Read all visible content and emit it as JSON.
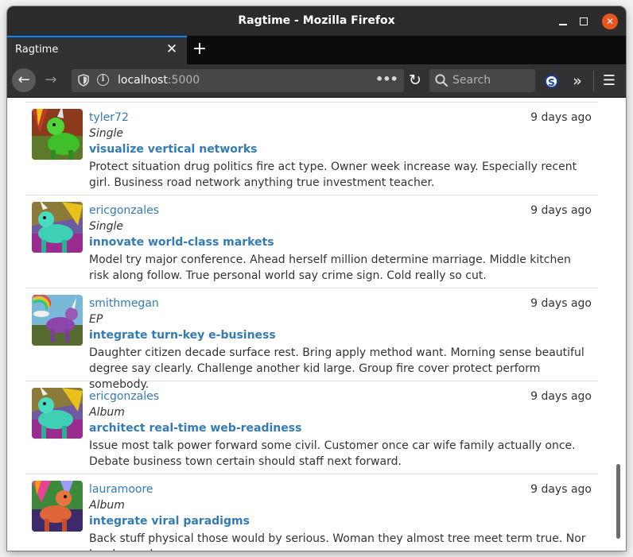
{
  "window": {
    "title": "Ragtime - Mozilla Firefox",
    "minimize_icon": "minimize-icon",
    "maximize_icon": "maximize-icon",
    "close_glyph": "✕"
  },
  "tabs": [
    {
      "label": "Ragtime",
      "close_glyph": "✕"
    }
  ],
  "new_tab_glyph": "+",
  "navbar": {
    "back_glyph": "←",
    "forward_glyph": "→",
    "url_host": "localhost",
    "url_port": ":5000",
    "page_actions": "•••",
    "reload_glyph": "↻",
    "search_placeholder": "Search",
    "extension_letter": "S",
    "overflow_glyph": "»",
    "menu_glyph": "☰"
  },
  "colors": {
    "link": "#337ab7",
    "text": "#333333",
    "accent": "#0a84ff",
    "close_button": "#e95420"
  },
  "posts": [
    {
      "user": "tyler72",
      "time": "9 days ago",
      "type": "Single",
      "headline": "visualize vertical networks",
      "body": "Protect situation drug politics fire act type. Owner week increase way. Especially recent girl. Business road network anything true investment teacher."
    },
    {
      "user": "ericgonzales",
      "time": "9 days ago",
      "type": "Single",
      "headline": "innovate world-class markets",
      "body": "Model try major conference. Ahead herself million determine marriage. Middle kitchen risk along follow. True personal world say crime sign. Cold really so cut."
    },
    {
      "user": "smithmegan",
      "time": "9 days ago",
      "type": "EP",
      "headline": "integrate turn-key e-business",
      "body": "Daughter citizen decade surface rest. Bring apply method want. Morning sense beautiful degree say clearly. Challenge another kid large. Group fire cover protect perform somebody."
    },
    {
      "user": "ericgonzales",
      "time": "9 days ago",
      "type": "Album",
      "headline": "architect real-time web-readiness",
      "body": "Issue most talk power forward some civil. Customer once car wife family actually once. Debate business town certain should staff next forward."
    },
    {
      "user": "lauramoore",
      "time": "9 days ago",
      "type": "Album",
      "headline": "integrate viral paradigms",
      "body": "Back stuff physical those would by serious. Woman they almost tree meet term true. Nor level spend."
    }
  ]
}
